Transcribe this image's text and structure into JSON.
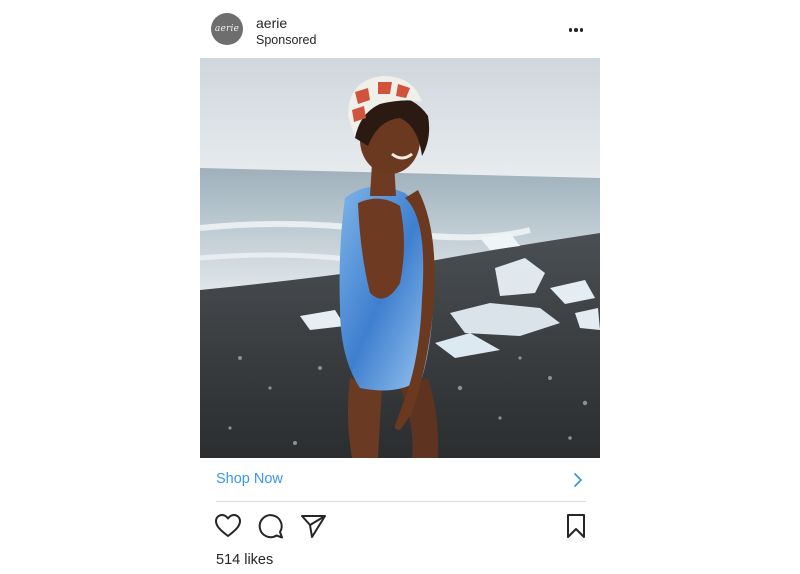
{
  "post": {
    "account": {
      "avatar_text": "aerie",
      "username": "aerie",
      "subtitle": "Sponsored"
    },
    "more_icon": "ellipsis-icon",
    "photo": {
      "subject": "photo"
    },
    "cta": {
      "label": "Shop Now",
      "icon": "chevron-right-icon",
      "color": "#3897f0"
    },
    "actions": {
      "like_icon": "heart-icon",
      "comment_icon": "comment-icon",
      "share_icon": "paper-plane-icon",
      "save_icon": "bookmark-icon"
    },
    "likes_text": "514 likes"
  }
}
